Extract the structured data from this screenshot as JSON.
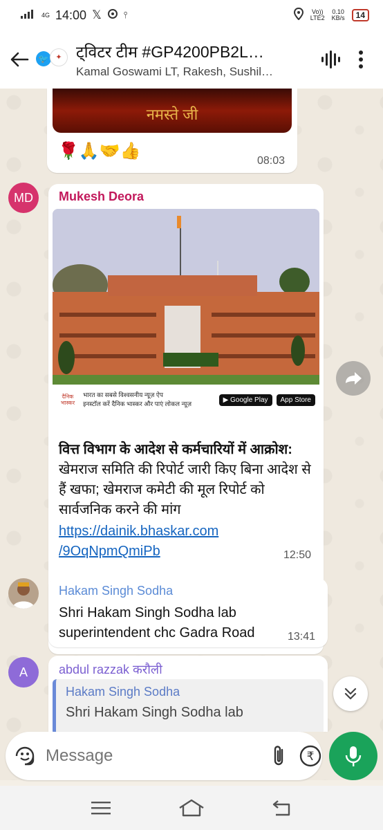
{
  "status_bar": {
    "time": "14:00",
    "network": "4G",
    "volte": "Vo))",
    "lte": "LTE2",
    "speed_value": "0.10",
    "speed_unit": "KB/s",
    "battery": "14"
  },
  "header": {
    "title": "ट्विटर टीम #GP4200PB2L…",
    "subtitle": "Kamal Goswami LT, Rakesh, Sushil…"
  },
  "messages": [
    {
      "emojis": "🌹🙏🤝👍",
      "time": "08:03",
      "image_text": "नमस्ते जी"
    },
    {
      "avatar_initials": "MD",
      "avatar_color": "#d6336c",
      "sender": "Mukesh Deora",
      "sender_color": "#c2185b",
      "promo_text_1": "भारत का सबसे विश्वसनीय न्यूज़ ऐप",
      "promo_text_2": "इनस्टॉल करें दैनिक भास्कर और पाएं लोकल न्यूज़",
      "promo_logo": "दैनिक भास्कर",
      "google_play": "Google Play",
      "app_store": "App Store",
      "headline_bold": "वित्त विभाग के आदेश से कर्मचारियों में आक्रोश:",
      "headline_rest": " खेमराज समिति की रिपोर्ट जारी किए बिना आदेश से हैं खफा; खेमराज कमेटी की मूल रिपोर्ट को सार्वजनिक करने की मांग",
      "link": "https://dainik.bhaskar.com/9OqNpmQmiPb",
      "link_line1": "https://dainik.bhaskar.com",
      "link_line2": "/9OqNpmQmiPb",
      "time": "12:50"
    },
    {
      "sender": "Hakam Singh Sodha",
      "sender_color": "#5b8bd6",
      "text_line1": "Shri Hakam Singh Sodha lab",
      "text_line2": "superintendent chc Gadra Road",
      "time": "13:41"
    },
    {
      "avatar_initials": "A",
      "avatar_color": "#8e6bd8",
      "sender": "abdul razzak करौली",
      "sender_color": "#7b5fd1",
      "quote_sender": "Hakam Singh Sodha",
      "quote_text": "Shri Hakam Singh Sodha lab"
    }
  ],
  "composer": {
    "placeholder": "Message"
  }
}
